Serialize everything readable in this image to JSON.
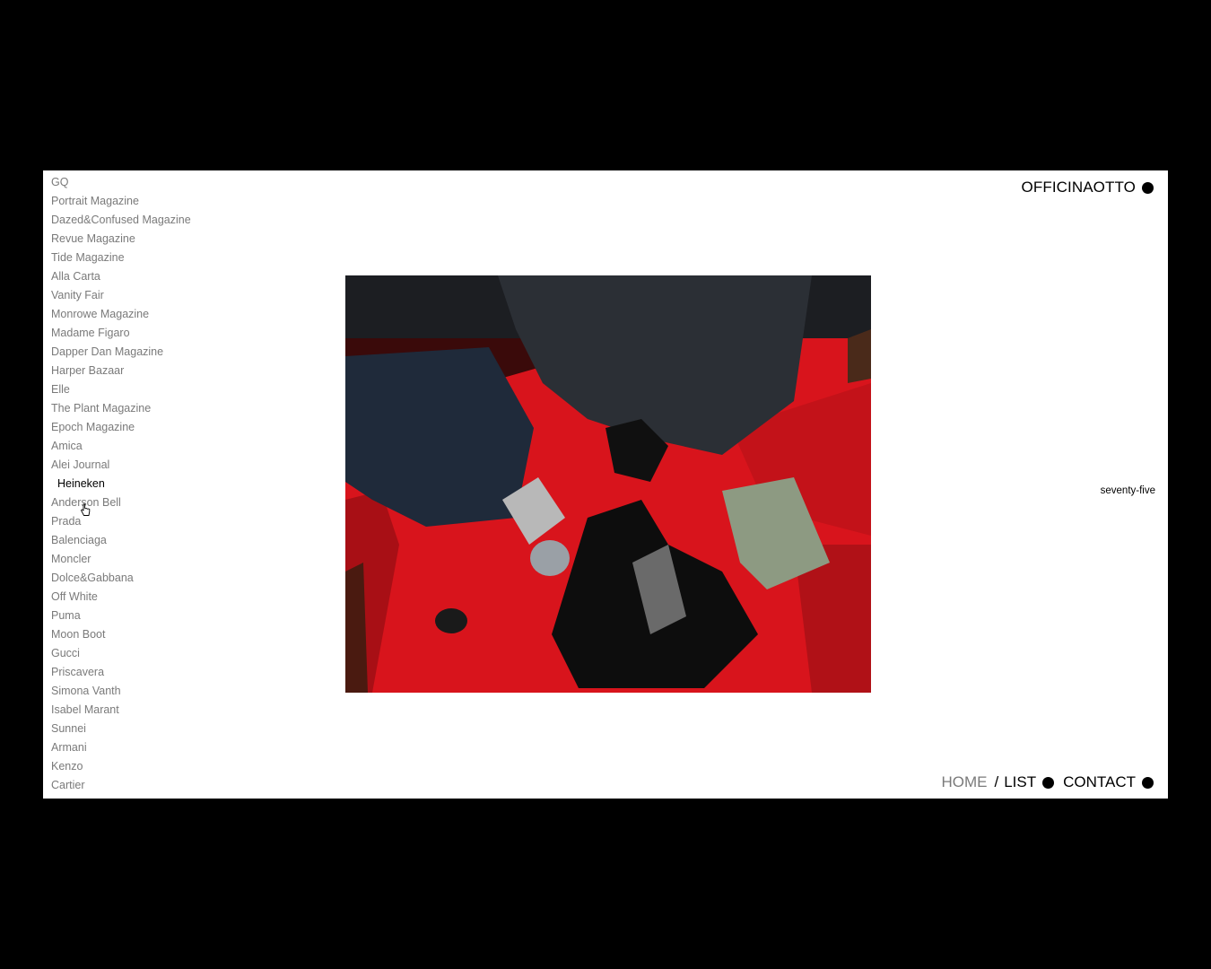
{
  "sidebar": {
    "items": [
      {
        "label": "GQ"
      },
      {
        "label": "Portrait Magazine"
      },
      {
        "label": "Dazed&Confused Magazine"
      },
      {
        "label": "Revue Magazine"
      },
      {
        "label": "Tide Magazine"
      },
      {
        "label": "Alla Carta"
      },
      {
        "label": "Vanity Fair"
      },
      {
        "label": "Monrowe Magazine"
      },
      {
        "label": "Madame Figaro"
      },
      {
        "label": "Dapper Dan Magazine"
      },
      {
        "label": "Harper Bazaar"
      },
      {
        "label": "Elle"
      },
      {
        "label": "The Plant Magazine"
      },
      {
        "label": "Epoch Magazine"
      },
      {
        "label": "Amica"
      },
      {
        "label": "Alei Journal"
      },
      {
        "label": "Heineken"
      },
      {
        "label": "Anderson Bell"
      },
      {
        "label": "Prada"
      },
      {
        "label": "Balenciaga"
      },
      {
        "label": "Moncler"
      },
      {
        "label": "Dolce&Gabbana"
      },
      {
        "label": "Off White"
      },
      {
        "label": "Puma"
      },
      {
        "label": "Moon Boot"
      },
      {
        "label": "Gucci"
      },
      {
        "label": "Priscavera"
      },
      {
        "label": "Simona Vanth"
      },
      {
        "label": "Isabel Marant"
      },
      {
        "label": "Sunnei"
      },
      {
        "label": "Armani"
      },
      {
        "label": "Kenzo"
      },
      {
        "label": "Cartier"
      }
    ],
    "active_label": "Heineken"
  },
  "header": {
    "brand": "OFFICINAOTTO"
  },
  "main": {
    "caption": "seventy-five"
  },
  "nav": {
    "home": "HOME",
    "separator": "/",
    "list": "LIST",
    "contact": "CONTACT"
  },
  "colors": {
    "background": "#000000",
    "panel": "#ffffff",
    "inactive_text": "#7a7a7a",
    "active_text": "#000000",
    "photo_red": "#d8141c"
  }
}
